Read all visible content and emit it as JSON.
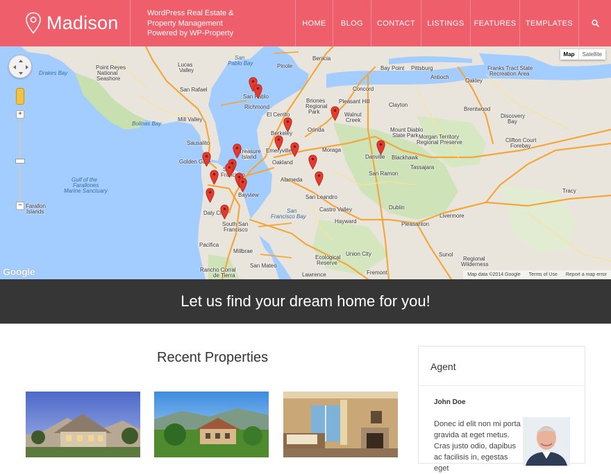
{
  "header": {
    "logo_text": "Madison",
    "tagline": [
      "WordPress Real Estate &",
      "Property Management",
      "Powered by WP-Property"
    ],
    "nav": [
      {
        "label": "HOME"
      },
      {
        "label": "BLOG"
      },
      {
        "label": "CONTACT"
      },
      {
        "label": "LISTINGS"
      },
      {
        "label": "FEATURES"
      },
      {
        "label": "TEMPLATES"
      }
    ],
    "search_icon": "search-icon",
    "bg_color": "#ee5e6b"
  },
  "map": {
    "type_buttons": {
      "map": "Map",
      "satellite": "Satellite"
    },
    "zoom_in": "+",
    "zoom_out": "−",
    "google": "Google",
    "attribution": [
      "Map data ©2014 Google",
      "Terms of Use",
      "Report a map error"
    ],
    "places": [
      {
        "name": "Drakes Bay",
        "kind": "water"
      },
      {
        "name": "Point Reyes",
        "kind": "land"
      },
      {
        "name": "National",
        "kind": "land"
      },
      {
        "name": "Seashore",
        "kind": "land"
      },
      {
        "name": "Lucas",
        "kind": "land"
      },
      {
        "name": "Valley",
        "kind": "land"
      },
      {
        "name": "San",
        "kind": "water"
      },
      {
        "name": "Pablo Bay",
        "kind": "water"
      },
      {
        "name": "Benicia",
        "kind": "land"
      },
      {
        "name": "Pinole",
        "kind": "land"
      },
      {
        "name": "Bay Point",
        "kind": "land"
      },
      {
        "name": "Pittsburg",
        "kind": "land"
      },
      {
        "name": "Antioch",
        "kind": "land"
      },
      {
        "name": "Oakley",
        "kind": "land"
      },
      {
        "name": "Franks Tract State",
        "kind": "land"
      },
      {
        "name": "Recreation Area",
        "kind": "land"
      },
      {
        "name": "San Rafael",
        "kind": "land"
      },
      {
        "name": "San Pablo",
        "kind": "land"
      },
      {
        "name": "Richmond",
        "kind": "land"
      },
      {
        "name": "Concord",
        "kind": "land"
      },
      {
        "name": "Pleasant Hill",
        "kind": "land"
      },
      {
        "name": "Clayton",
        "kind": "land"
      },
      {
        "name": "Brentwood",
        "kind": "land"
      },
      {
        "name": "Discovery",
        "kind": "land"
      },
      {
        "name": "Bay",
        "kind": "land"
      },
      {
        "name": "Briones",
        "kind": "land"
      },
      {
        "name": "Regional",
        "kind": "land"
      },
      {
        "name": "Park",
        "kind": "land"
      },
      {
        "name": "Mill Valley",
        "kind": "land"
      },
      {
        "name": "El Cerrito",
        "kind": "land"
      },
      {
        "name": "Walnut",
        "kind": "land"
      },
      {
        "name": "Creek",
        "kind": "land"
      },
      {
        "name": "Mount Diablo",
        "kind": "land"
      },
      {
        "name": "State Park",
        "kind": "land"
      },
      {
        "name": "Bolinas Bay",
        "kind": "water"
      },
      {
        "name": "Berkeley",
        "kind": "land"
      },
      {
        "name": "Orinda",
        "kind": "land"
      },
      {
        "name": "Morgan Territory",
        "kind": "land"
      },
      {
        "name": "Regional Preserve",
        "kind": "land"
      },
      {
        "name": "Clifton Court",
        "kind": "land"
      },
      {
        "name": "Forebay",
        "kind": "land"
      },
      {
        "name": "Sausalito",
        "kind": "land"
      },
      {
        "name": "Treasure",
        "kind": "land"
      },
      {
        "name": "Island",
        "kind": "land"
      },
      {
        "name": "Emeryville",
        "kind": "land"
      },
      {
        "name": "Moraga",
        "kind": "land"
      },
      {
        "name": "Danville",
        "kind": "land"
      },
      {
        "name": "Blackhawk",
        "kind": "land"
      },
      {
        "name": "Golden Gate",
        "kind": "land"
      },
      {
        "name": "Oakland",
        "kind": "land"
      },
      {
        "name": "San Ramon",
        "kind": "land"
      },
      {
        "name": "Tassajara",
        "kind": "land"
      },
      {
        "name": "San",
        "kind": "land"
      },
      {
        "name": "Francisco",
        "kind": "land"
      },
      {
        "name": "Alameda",
        "kind": "land"
      },
      {
        "name": "Gulf of the",
        "kind": "water"
      },
      {
        "name": "Farallones",
        "kind": "water"
      },
      {
        "name": "Marine Sanctuary",
        "kind": "water"
      },
      {
        "name": "Tracy",
        "kind": "land"
      },
      {
        "name": "Bayview",
        "kind": "land"
      },
      {
        "name": "San Leandro",
        "kind": "land"
      },
      {
        "name": "Farallon",
        "kind": "land"
      },
      {
        "name": "Islands",
        "kind": "land"
      },
      {
        "name": "Daly City",
        "kind": "land"
      },
      {
        "name": "Castro Valley",
        "kind": "land"
      },
      {
        "name": "Dublin",
        "kind": "land"
      },
      {
        "name": "Pleasanton",
        "kind": "land"
      },
      {
        "name": "Livermore",
        "kind": "land"
      },
      {
        "name": "South San",
        "kind": "land"
      },
      {
        "name": "Francisco",
        "kind": "land"
      },
      {
        "name": "San",
        "kind": "water"
      },
      {
        "name": "Francisco Bay",
        "kind": "water"
      },
      {
        "name": "Hayward",
        "kind": "land"
      },
      {
        "name": "Pacifica",
        "kind": "land"
      },
      {
        "name": "Millbrae",
        "kind": "land"
      },
      {
        "name": "Union City",
        "kind": "land"
      },
      {
        "name": "Ecological",
        "kind": "land"
      },
      {
        "name": "Reserve",
        "kind": "land"
      },
      {
        "name": "Sunol",
        "kind": "land"
      },
      {
        "name": "Regional",
        "kind": "land"
      },
      {
        "name": "Wilderness",
        "kind": "land"
      },
      {
        "name": "Rancho Corral",
        "kind": "land"
      },
      {
        "name": "de Tierra",
        "kind": "land"
      },
      {
        "name": "San Mateo",
        "kind": "land"
      },
      {
        "name": "Fremont",
        "kind": "land"
      },
      {
        "name": "Lawrence",
        "kind": "land"
      }
    ],
    "pin_color": "#e53b2f"
  },
  "banner": {
    "text": "Let us find your dream home for you!"
  },
  "recent": {
    "title": "Recent Properties",
    "properties": [
      {
        "name": "property-photo-1"
      },
      {
        "name": "property-photo-2"
      },
      {
        "name": "property-photo-3"
      }
    ]
  },
  "agent": {
    "heading": "Agent",
    "name": "John Doe",
    "bio": "Donec id elit non mi porta gravida at eget metus. Cras justo odio, dapibus ac facilisis in, egestas eget"
  }
}
